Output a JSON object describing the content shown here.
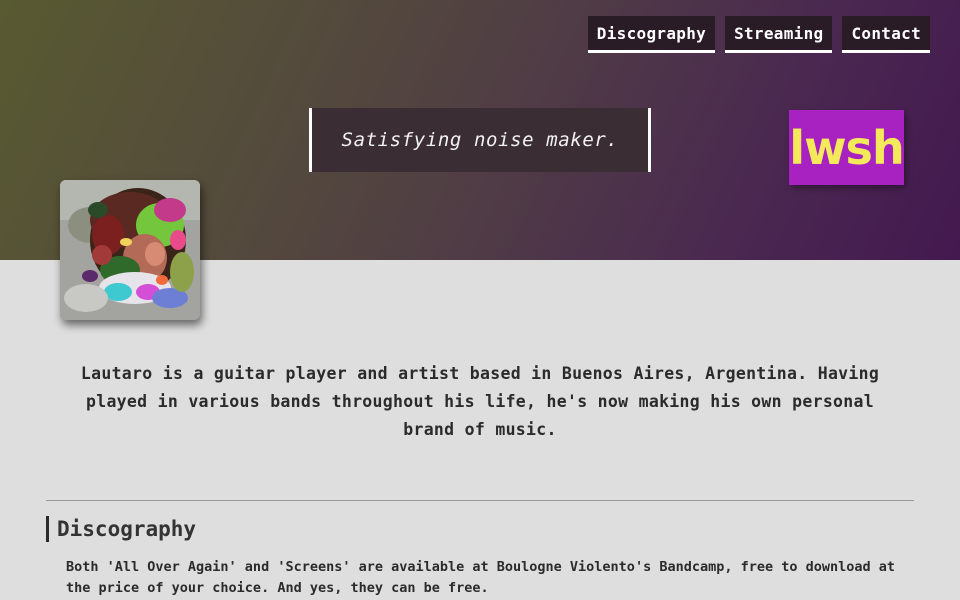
{
  "nav": {
    "items": [
      {
        "label": "Discography"
      },
      {
        "label": "Streaming"
      },
      {
        "label": "Contact"
      }
    ]
  },
  "hero": {
    "tagline": "Satisfying noise maker.",
    "logo_text": "lwsh",
    "avatar_icon": "artist-portrait-image"
  },
  "bio": {
    "text": "Lautaro is a guitar player and artist based in Buenos Aires, Argentina. Having played in various bands throughout his life, he's now making his own personal brand of music."
  },
  "discography": {
    "title": "Discography",
    "text": "Both 'All Over Again' and 'Screens' are available at Boulogne Violento's Bandcamp, free to download at the price of your choice. And yes, they can be free."
  },
  "colors": {
    "hero_gradient_start": "#585a31",
    "hero_gradient_end": "#43194f",
    "logo_background": "#a722c1",
    "logo_text": "#f4e95a",
    "page_background": "#dedede"
  }
}
